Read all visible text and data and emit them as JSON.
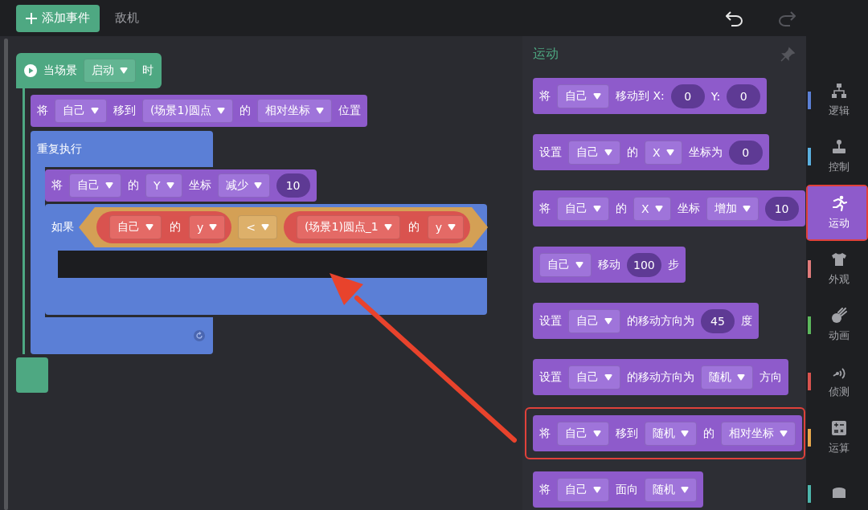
{
  "toolbar": {
    "add_button": "添加事件",
    "sprite_tab": "敌机",
    "undo": {
      "disabled": false
    },
    "redo": {
      "disabled": true
    }
  },
  "script": {
    "hat": [
      {
        "kind": "label",
        "text": "当场景"
      },
      {
        "kind": "dropdown",
        "text": "启动"
      },
      {
        "kind": "label",
        "text": "时"
      }
    ],
    "body": [
      {
        "kind": "statement",
        "parts": [
          {
            "kind": "label",
            "text": "将"
          },
          {
            "kind": "dropdown",
            "text": "自己"
          },
          {
            "kind": "label",
            "text": "移到"
          },
          {
            "kind": "dropdown",
            "text": "(场景1)圆点"
          },
          {
            "kind": "label",
            "text": "的"
          },
          {
            "kind": "dropdown",
            "text": "相对坐标"
          },
          {
            "kind": "label",
            "text": "位置"
          }
        ]
      },
      {
        "kind": "loop",
        "label": "重复执行",
        "body": [
          {
            "kind": "statement",
            "parts": [
              {
                "kind": "label",
                "text": "将"
              },
              {
                "kind": "dropdown",
                "text": "自己"
              },
              {
                "kind": "label",
                "text": "的"
              },
              {
                "kind": "dropdown",
                "text": "Y"
              },
              {
                "kind": "label",
                "text": "坐标"
              },
              {
                "kind": "dropdown",
                "text": "减少"
              },
              {
                "kind": "number",
                "text": "10"
              }
            ]
          },
          {
            "kind": "if",
            "label": "如果",
            "condition": [
              {
                "kind": "reporter",
                "parts": [
                  {
                    "kind": "dropdown",
                    "text": "自己"
                  },
                  {
                    "kind": "label",
                    "text": "的"
                  },
                  {
                    "kind": "dropdown",
                    "text": "y"
                  }
                ]
              },
              {
                "kind": "dropdown",
                "text": "<"
              },
              {
                "kind": "reporter",
                "parts": [
                  {
                    "kind": "dropdown",
                    "text": "(场景1)圆点_1"
                  },
                  {
                    "kind": "label",
                    "text": "的"
                  },
                  {
                    "kind": "dropdown",
                    "text": "y"
                  }
                ]
              }
            ]
          }
        ]
      }
    ]
  },
  "palette": {
    "title": "运动",
    "blocks": [
      {
        "annotated": false,
        "parts": [
          {
            "kind": "label",
            "text": "将"
          },
          {
            "kind": "dropdown",
            "text": "自己"
          },
          {
            "kind": "label",
            "text": "移动到 X:"
          },
          {
            "kind": "number",
            "text": "0"
          },
          {
            "kind": "label",
            "text": "Y:"
          },
          {
            "kind": "number",
            "text": "0"
          }
        ]
      },
      {
        "annotated": false,
        "parts": [
          {
            "kind": "label",
            "text": "设置"
          },
          {
            "kind": "dropdown",
            "text": "自己"
          },
          {
            "kind": "label",
            "text": "的"
          },
          {
            "kind": "dropdown",
            "text": "X"
          },
          {
            "kind": "label",
            "text": "坐标为"
          },
          {
            "kind": "number",
            "text": "0"
          }
        ]
      },
      {
        "annotated": false,
        "parts": [
          {
            "kind": "label",
            "text": "将"
          },
          {
            "kind": "dropdown",
            "text": "自己"
          },
          {
            "kind": "label",
            "text": "的"
          },
          {
            "kind": "dropdown",
            "text": "X"
          },
          {
            "kind": "label",
            "text": "坐标"
          },
          {
            "kind": "dropdown",
            "text": "增加"
          },
          {
            "kind": "number",
            "text": "10"
          }
        ]
      },
      {
        "annotated": false,
        "parts": [
          {
            "kind": "dropdown",
            "text": "自己"
          },
          {
            "kind": "label",
            "text": "移动"
          },
          {
            "kind": "number",
            "text": "100"
          },
          {
            "kind": "label",
            "text": "步"
          }
        ]
      },
      {
        "annotated": false,
        "parts": [
          {
            "kind": "label",
            "text": "设置"
          },
          {
            "kind": "dropdown",
            "text": "自己"
          },
          {
            "kind": "label",
            "text": "的移动方向为"
          },
          {
            "kind": "number",
            "text": "45"
          },
          {
            "kind": "label",
            "text": "度"
          }
        ]
      },
      {
        "annotated": false,
        "parts": [
          {
            "kind": "label",
            "text": "设置"
          },
          {
            "kind": "dropdown",
            "text": "自己"
          },
          {
            "kind": "label",
            "text": "的移动方向为"
          },
          {
            "kind": "dropdown",
            "text": "随机"
          },
          {
            "kind": "label",
            "text": "方向"
          }
        ]
      },
      {
        "annotated": true,
        "parts": [
          {
            "kind": "label",
            "text": "将"
          },
          {
            "kind": "dropdown",
            "text": "自己"
          },
          {
            "kind": "label",
            "text": "移到"
          },
          {
            "kind": "dropdown",
            "text": "随机"
          },
          {
            "kind": "label",
            "text": "的"
          },
          {
            "kind": "dropdown",
            "text": "相对坐标"
          }
        ]
      },
      {
        "annotated": false,
        "parts": [
          {
            "kind": "label",
            "text": "将"
          },
          {
            "kind": "dropdown",
            "text": "自己"
          },
          {
            "kind": "label",
            "text": "面向"
          },
          {
            "kind": "dropdown",
            "text": "随机"
          }
        ]
      }
    ]
  },
  "categories": [
    {
      "label": "逻辑",
      "color": "#5b80d6",
      "selected": false,
      "annotated": false
    },
    {
      "label": "控制",
      "color": "#5ab0e0",
      "selected": false,
      "annotated": false
    },
    {
      "label": "运动",
      "color": "#8e5bcb",
      "selected": true,
      "annotated": true
    },
    {
      "label": "外观",
      "color": "#e07b7b",
      "selected": false,
      "annotated": false
    },
    {
      "label": "动画",
      "color": "#5cb85c",
      "selected": false,
      "annotated": false
    },
    {
      "label": "侦测",
      "color": "#d9534f",
      "selected": false,
      "annotated": false
    },
    {
      "label": "运算",
      "color": "#e8a84c",
      "selected": false,
      "annotated": false
    },
    {
      "color": "#4db6ac",
      "selected": false,
      "annotated": false
    }
  ]
}
